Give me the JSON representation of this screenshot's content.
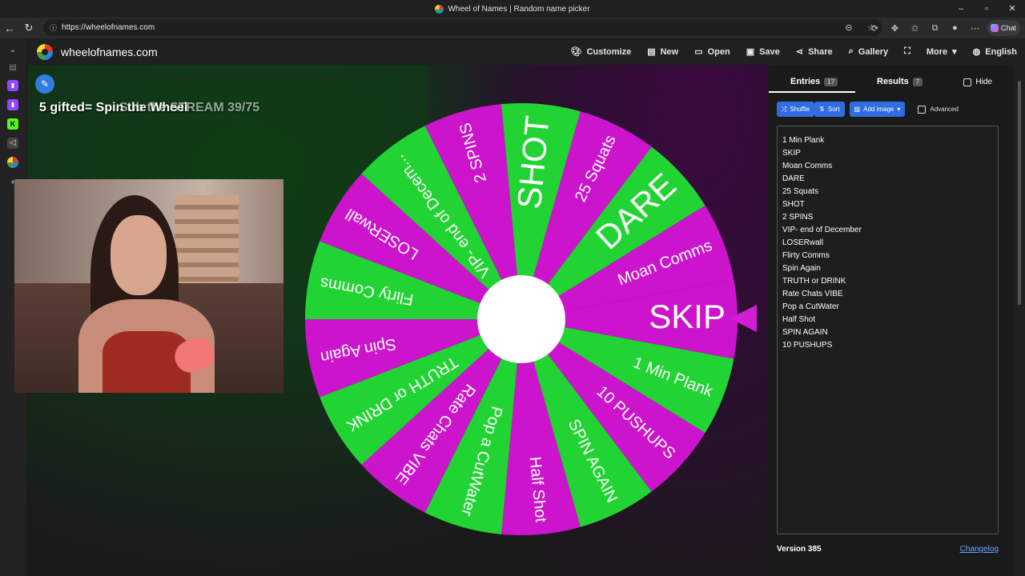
{
  "browser": {
    "window_title": "Wheel of Names | Random name picker",
    "url": "https://wheelofnames.com",
    "chat_label": "Chat",
    "win_controls": [
      "–",
      "▫",
      "✕"
    ]
  },
  "app": {
    "site_name": "wheelofnames.com",
    "menu": [
      {
        "label": "Customize",
        "icon": "palette-icon"
      },
      {
        "label": "New",
        "icon": "file-icon"
      },
      {
        "label": "Open",
        "icon": "folder-icon"
      },
      {
        "label": "Save",
        "icon": "save-icon"
      },
      {
        "label": "Share",
        "icon": "share-icon"
      },
      {
        "label": "Gallery",
        "icon": "search-icon"
      },
      {
        "label": "",
        "icon": "fullscreen-icon"
      },
      {
        "label": "More",
        "icon": "chevron-down-icon"
      },
      {
        "label": "English",
        "icon": "globe-icon"
      }
    ]
  },
  "overlay": {
    "text": "5 gifted= Spin the Wheel",
    "ghost": "Sub the STREAM 39/75"
  },
  "wheel": {
    "colors": {
      "green": "#22d433",
      "magenta": "#cc14cc"
    },
    "segments": [
      "SKIP",
      "1 Min Plank",
      "10 PUSHUPS",
      "SPIN AGAIN",
      "Half Shot",
      "Pop a CutWater",
      "Rate Chats VIBE",
      "TRUTH or DRINK",
      "Spin Again",
      "Flirty Comms",
      "LOSERwall",
      "VIP- end of Decem...",
      "2 SPINS",
      "SHOT",
      "25 Squats",
      "DARE",
      "Moan Comms"
    ]
  },
  "panel": {
    "tab_entries": "Entries",
    "entries_count": "17",
    "tab_results": "Results",
    "results_count": "7",
    "hide_label": "Hide",
    "shuffle_label": "Shuffle",
    "sort_label": "Sort",
    "add_image_label": "Add image",
    "advanced_label": "Advanced",
    "entries": [
      "1 Min Plank",
      "SKIP",
      "Moan Comms",
      "DARE",
      "25 Squats",
      "SHOT",
      "2 SPINS",
      "VIP- end of December",
      "LOSERwall",
      "Flirty Comms",
      "Spin Again",
      "TRUTH or DRINK",
      "Rate Chats VIBE",
      "Pop a CutWater",
      "Half Shot",
      "SPIN AGAIN",
      "10 PUSHUPS"
    ],
    "version": "Version 385",
    "changelog": "Changelog"
  }
}
